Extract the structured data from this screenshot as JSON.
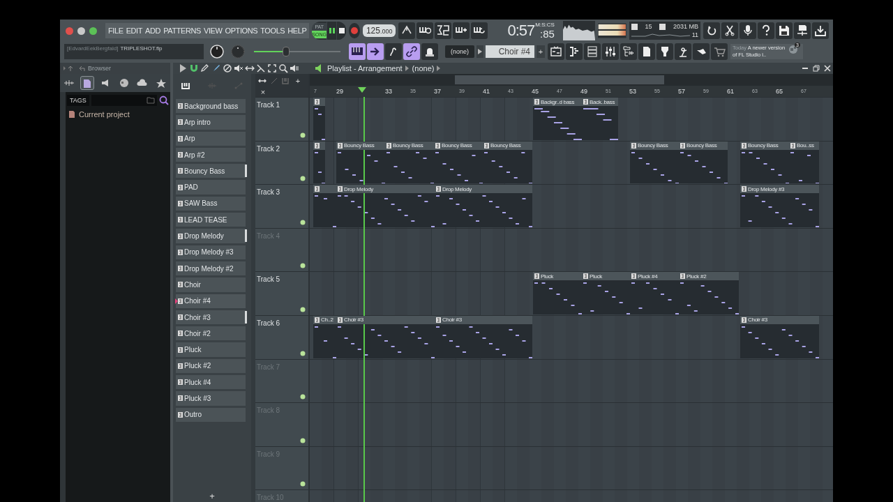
{
  "menu": [
    "FILE",
    "EDIT",
    "ADD",
    "PATTERNS",
    "VIEW",
    "OPTIONS",
    "TOOLS",
    "HELP"
  ],
  "transport": {
    "modes": [
      {
        "label": "PAT",
        "selected": false
      },
      {
        "label": "SONG",
        "selected": true
      }
    ]
  },
  "tempo": {
    "whole": "125",
    "fraction": ".000"
  },
  "time": {
    "main": "0:57",
    "sub": ":85",
    "unit": "M:S:CS"
  },
  "cpu": {
    "polyphony": "15",
    "memory": "2031 MB",
    "cores": "11"
  },
  "hint": {
    "user": "[EdvardEekBergfald]",
    "file": "TRIPLESHOT.flp"
  },
  "master_volume": {
    "level": 0.37
  },
  "pattern_selector": {
    "channel": "(none)",
    "pattern": "Choir #4",
    "add": "+"
  },
  "news": {
    "day": "Today",
    "text": "A newer version of FL Studio i..",
    "count": "3"
  },
  "browser": {
    "title": "Browser",
    "tabs": [
      {
        "selected": false
      },
      {
        "selected": true
      },
      {
        "selected": false
      },
      {
        "selected": false
      },
      {
        "selected": false
      },
      {
        "selected": false
      }
    ],
    "tags_label": "TAGS",
    "items": [
      "Current project"
    ]
  },
  "playlist": {
    "title": "Playlist - Arrangement",
    "arrangement": "(none)",
    "add_track": "+",
    "remove": "×",
    "ruler": [
      "7",
      "29",
      "33",
      "35",
      "37",
      "39",
      "41",
      "43",
      "45",
      "47",
      "49",
      "51",
      "53",
      "55",
      "57",
      "59",
      "61",
      "63",
      "65",
      "67"
    ],
    "patterns": [
      {
        "label": "Background bass",
        "selected": false,
        "marked": false
      },
      {
        "label": "Arp intro",
        "selected": false,
        "marked": false
      },
      {
        "label": "Arp",
        "selected": false,
        "marked": false
      },
      {
        "label": "Arp #2",
        "selected": false,
        "marked": false
      },
      {
        "label": "Bouncy Bass",
        "selected": false,
        "marked": true
      },
      {
        "label": "PAD",
        "selected": false,
        "marked": false
      },
      {
        "label": "SAW Bass",
        "selected": false,
        "marked": false
      },
      {
        "label": "LEAD TEASE",
        "selected": false,
        "marked": false
      },
      {
        "label": "Drop Melody",
        "selected": false,
        "marked": true
      },
      {
        "label": "Drop Melody #3",
        "selected": false,
        "marked": false
      },
      {
        "label": "Drop Melody #2",
        "selected": false,
        "marked": false
      },
      {
        "label": "Choir",
        "selected": false,
        "marked": false
      },
      {
        "label": "Choir #4",
        "selected": true,
        "marked": false
      },
      {
        "label": "Choir #3",
        "selected": false,
        "marked": true
      },
      {
        "label": "Choir #2",
        "selected": false,
        "marked": false
      },
      {
        "label": "Pluck",
        "selected": false,
        "marked": false
      },
      {
        "label": "Pluck #2",
        "selected": false,
        "marked": false
      },
      {
        "label": "Pluck #4",
        "selected": false,
        "marked": false
      },
      {
        "label": "Pluck #3",
        "selected": false,
        "marked": false
      },
      {
        "label": "Outro",
        "selected": false,
        "marked": false
      }
    ],
    "picker_add": "+",
    "tracks": [
      {
        "name": "Track 1",
        "dimmed": false,
        "clips": [
          {
            "kind": "stub"
          },
          {
            "kind": "pattern",
            "label": "Backgr..d bass"
          },
          {
            "kind": "pattern",
            "label": "Back..bass"
          }
        ]
      },
      {
        "name": "Track 2",
        "dimmed": false,
        "clips": [
          {
            "kind": "stub"
          },
          {
            "kind": "pattern",
            "label": "Bouncy Bass"
          },
          {
            "kind": "pattern",
            "label": "Bouncy Bass"
          },
          {
            "kind": "pattern",
            "label": "Bouncy Bass"
          },
          {
            "kind": "pattern",
            "label": "Bouncy Bass"
          },
          {
            "kind": "pattern",
            "label": "Bouncy Bass"
          },
          {
            "kind": "pattern",
            "label": "Bouncy Bass"
          },
          {
            "kind": "pattern",
            "label": "Bouncy Bass"
          },
          {
            "kind": "pattern",
            "label": "Bou..ss"
          }
        ]
      },
      {
        "name": "Track 3",
        "dimmed": false,
        "clips": [
          {
            "kind": "stub"
          },
          {
            "kind": "pattern",
            "label": "Drop Melody"
          },
          {
            "kind": "pattern",
            "label": "Drop Melody"
          },
          {
            "kind": "pattern",
            "label": "Drop Melody #3"
          }
        ]
      },
      {
        "name": "Track 4",
        "dimmed": true
      },
      {
        "name": "Track 5",
        "dimmed": false,
        "clips": [
          {
            "kind": "pattern",
            "label": "Pluck"
          },
          {
            "kind": "pattern",
            "label": "Pluck"
          },
          {
            "kind": "pattern",
            "label": "Pluck #4"
          },
          {
            "kind": "pattern",
            "label": "Pluck #2"
          }
        ]
      },
      {
        "name": "Track 6",
        "dimmed": false,
        "clips": [
          {
            "kind": "pattern",
            "label": "Ch..2"
          },
          {
            "kind": "pattern",
            "label": "Choir #3"
          },
          {
            "kind": "pattern",
            "label": "Choir #3"
          },
          {
            "kind": "pattern",
            "label": "Choir #3"
          }
        ]
      },
      {
        "name": "Track 7",
        "dimmed": true
      },
      {
        "name": "Track 8",
        "dimmed": true
      },
      {
        "name": "Track 9",
        "dimmed": true
      },
      {
        "name": "Track 10",
        "dimmed": true
      }
    ]
  }
}
